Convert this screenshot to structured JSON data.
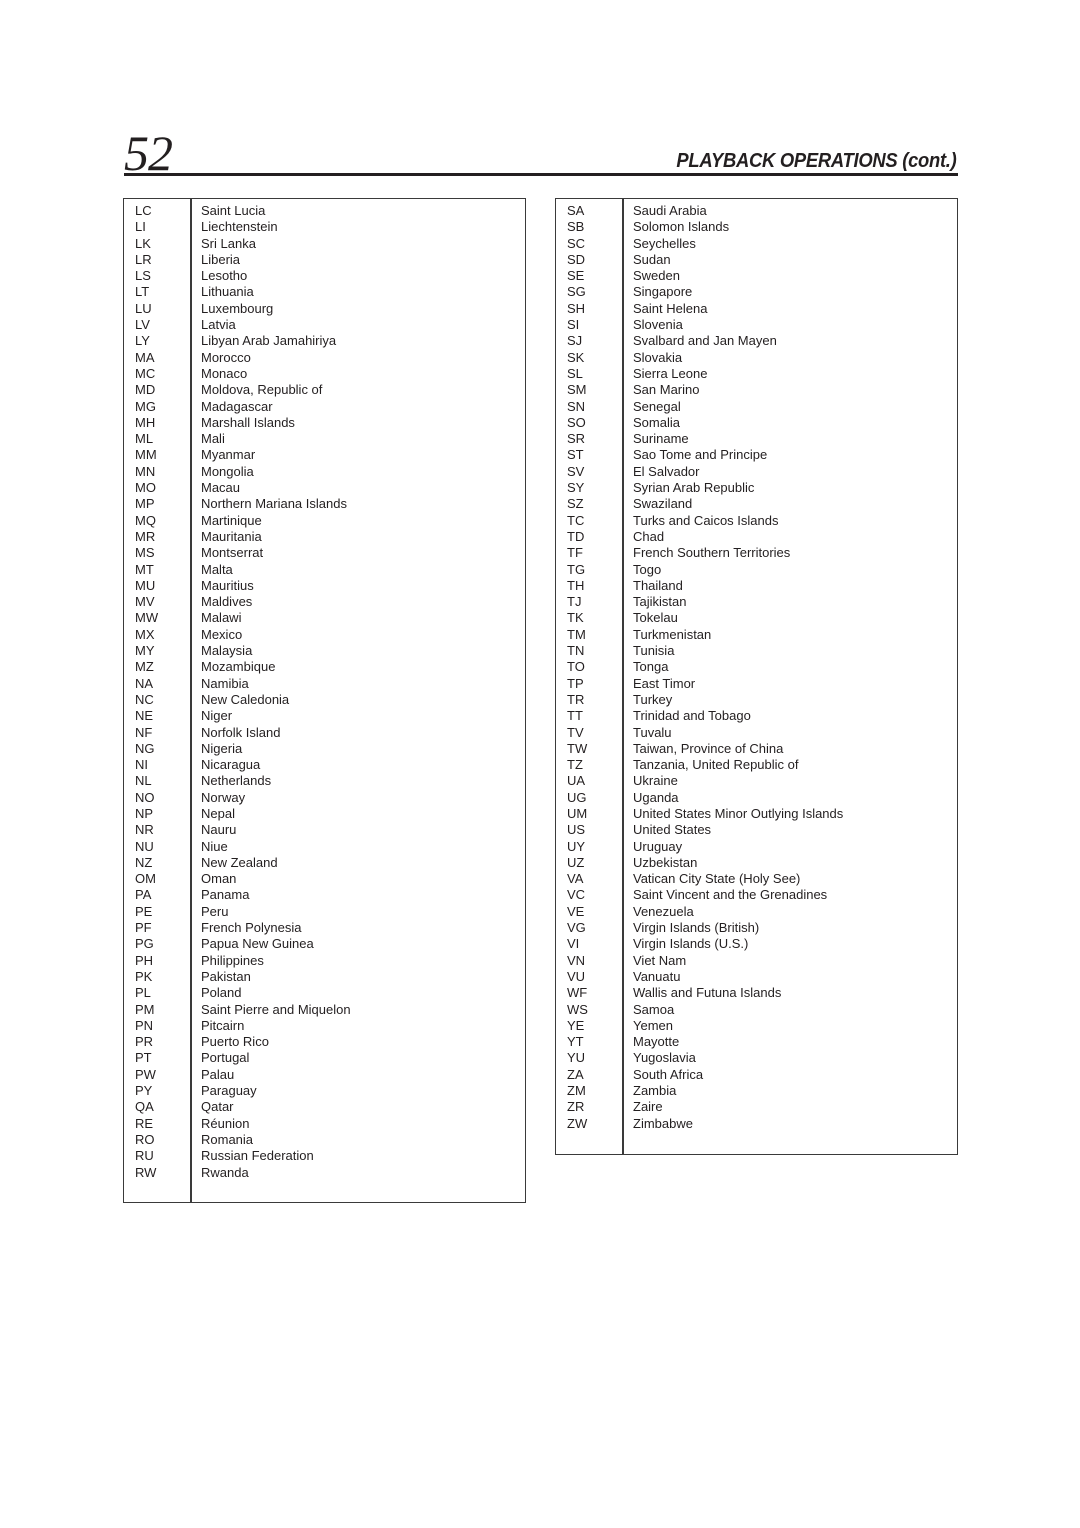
{
  "header": {
    "page_number": "52",
    "section_title": "PLAYBACK OPERATIONS (cont.)"
  },
  "left_table": [
    {
      "code": "LC",
      "name": "Saint Lucia"
    },
    {
      "code": "LI",
      "name": "Liechtenstein"
    },
    {
      "code": "LK",
      "name": "Sri Lanka"
    },
    {
      "code": "LR",
      "name": "Liberia"
    },
    {
      "code": "LS",
      "name": "Lesotho"
    },
    {
      "code": "LT",
      "name": "Lithuania"
    },
    {
      "code": "LU",
      "name": "Luxembourg"
    },
    {
      "code": "LV",
      "name": "Latvia"
    },
    {
      "code": "LY",
      "name": "Libyan Arab Jamahiriya"
    },
    {
      "code": "MA",
      "name": "Morocco"
    },
    {
      "code": "MC",
      "name": "Monaco"
    },
    {
      "code": "MD",
      "name": "Moldova, Republic of"
    },
    {
      "code": "MG",
      "name": "Madagascar"
    },
    {
      "code": "MH",
      "name": "Marshall Islands"
    },
    {
      "code": "ML",
      "name": "Mali"
    },
    {
      "code": "MM",
      "name": "Myanmar"
    },
    {
      "code": "MN",
      "name": "Mongolia"
    },
    {
      "code": "MO",
      "name": "Macau"
    },
    {
      "code": "MP",
      "name": "Northern Mariana Islands"
    },
    {
      "code": "MQ",
      "name": "Martinique"
    },
    {
      "code": "MR",
      "name": "Mauritania"
    },
    {
      "code": "MS",
      "name": "Montserrat"
    },
    {
      "code": "MT",
      "name": "Malta"
    },
    {
      "code": "MU",
      "name": "Mauritius"
    },
    {
      "code": "MV",
      "name": "Maldives"
    },
    {
      "code": "MW",
      "name": "Malawi"
    },
    {
      "code": "MX",
      "name": "Mexico"
    },
    {
      "code": "MY",
      "name": "Malaysia"
    },
    {
      "code": "MZ",
      "name": "Mozambique"
    },
    {
      "code": "NA",
      "name": "Namibia"
    },
    {
      "code": "NC",
      "name": "New Caledonia"
    },
    {
      "code": "NE",
      "name": "Niger"
    },
    {
      "code": "NF",
      "name": "Norfolk Island"
    },
    {
      "code": "NG",
      "name": "Nigeria"
    },
    {
      "code": "NI",
      "name": "Nicaragua"
    },
    {
      "code": "NL",
      "name": "Netherlands"
    },
    {
      "code": "NO",
      "name": "Norway"
    },
    {
      "code": "NP",
      "name": "Nepal"
    },
    {
      "code": "NR",
      "name": "Nauru"
    },
    {
      "code": "NU",
      "name": "Niue"
    },
    {
      "code": "NZ",
      "name": "New Zealand"
    },
    {
      "code": "OM",
      "name": "Oman"
    },
    {
      "code": "PA",
      "name": "Panama"
    },
    {
      "code": "PE",
      "name": "Peru"
    },
    {
      "code": "PF",
      "name": "French Polynesia"
    },
    {
      "code": "PG",
      "name": "Papua New Guinea"
    },
    {
      "code": "PH",
      "name": "Philippines"
    },
    {
      "code": "PK",
      "name": "Pakistan"
    },
    {
      "code": "PL",
      "name": "Poland"
    },
    {
      "code": "PM",
      "name": "Saint Pierre and Miquelon"
    },
    {
      "code": "PN",
      "name": "Pitcairn"
    },
    {
      "code": "PR",
      "name": "Puerto Rico"
    },
    {
      "code": "PT",
      "name": "Portugal"
    },
    {
      "code": "PW",
      "name": "Palau"
    },
    {
      "code": "PY",
      "name": "Paraguay"
    },
    {
      "code": "QA",
      "name": "Qatar"
    },
    {
      "code": "RE",
      "name": "Réunion"
    },
    {
      "code": "RO",
      "name": "Romania"
    },
    {
      "code": "RU",
      "name": "Russian Federation"
    },
    {
      "code": "RW",
      "name": "Rwanda"
    }
  ],
  "right_table": [
    {
      "code": "SA",
      "name": "Saudi Arabia"
    },
    {
      "code": "SB",
      "name": "Solomon Islands"
    },
    {
      "code": "SC",
      "name": "Seychelles"
    },
    {
      "code": "SD",
      "name": "Sudan"
    },
    {
      "code": "SE",
      "name": "Sweden"
    },
    {
      "code": "SG",
      "name": "Singapore"
    },
    {
      "code": "SH",
      "name": "Saint Helena"
    },
    {
      "code": "SI",
      "name": "Slovenia"
    },
    {
      "code": "SJ",
      "name": "Svalbard and Jan Mayen"
    },
    {
      "code": "SK",
      "name": "Slovakia"
    },
    {
      "code": "SL",
      "name": "Sierra Leone"
    },
    {
      "code": "SM",
      "name": "San Marino"
    },
    {
      "code": "SN",
      "name": "Senegal"
    },
    {
      "code": "SO",
      "name": "Somalia"
    },
    {
      "code": "SR",
      "name": "Suriname"
    },
    {
      "code": "ST",
      "name": "Sao Tome and Principe"
    },
    {
      "code": "SV",
      "name": "El Salvador"
    },
    {
      "code": "SY",
      "name": "Syrian Arab Republic"
    },
    {
      "code": "SZ",
      "name": "Swaziland"
    },
    {
      "code": "TC",
      "name": "Turks and Caicos Islands"
    },
    {
      "code": "TD",
      "name": "Chad"
    },
    {
      "code": "TF",
      "name": "French Southern Territories"
    },
    {
      "code": "TG",
      "name": "Togo"
    },
    {
      "code": "TH",
      "name": "Thailand"
    },
    {
      "code": "TJ",
      "name": "Tajikistan"
    },
    {
      "code": "TK",
      "name": "Tokelau"
    },
    {
      "code": "TM",
      "name": "Turkmenistan"
    },
    {
      "code": "TN",
      "name": "Tunisia"
    },
    {
      "code": "TO",
      "name": "Tonga"
    },
    {
      "code": "TP",
      "name": "East Timor"
    },
    {
      "code": "TR",
      "name": "Turkey"
    },
    {
      "code": "TT",
      "name": "Trinidad and Tobago"
    },
    {
      "code": "TV",
      "name": "Tuvalu"
    },
    {
      "code": "TW",
      "name": "Taiwan, Province of China"
    },
    {
      "code": "TZ",
      "name": "Tanzania, United Republic of"
    },
    {
      "code": "UA",
      "name": "Ukraine"
    },
    {
      "code": "UG",
      "name": "Uganda"
    },
    {
      "code": "UM",
      "name": "United States Minor Outlying Islands"
    },
    {
      "code": "US",
      "name": "United States"
    },
    {
      "code": "UY",
      "name": "Uruguay"
    },
    {
      "code": "UZ",
      "name": "Uzbekistan"
    },
    {
      "code": "VA",
      "name": "Vatican City State (Holy See)"
    },
    {
      "code": "VC",
      "name": "Saint Vincent and the Grenadines"
    },
    {
      "code": "VE",
      "name": "Venezuela"
    },
    {
      "code": "VG",
      "name": "Virgin Islands (British)"
    },
    {
      "code": "VI",
      "name": "Virgin Islands (U.S.)"
    },
    {
      "code": "VN",
      "name": "Viet Nam"
    },
    {
      "code": "VU",
      "name": "Vanuatu"
    },
    {
      "code": "WF",
      "name": "Wallis and Futuna Islands"
    },
    {
      "code": "WS",
      "name": "Samoa"
    },
    {
      "code": "YE",
      "name": "Yemen"
    },
    {
      "code": "YT",
      "name": "Mayotte"
    },
    {
      "code": "YU",
      "name": "Yugoslavia"
    },
    {
      "code": "ZA",
      "name": "South Africa"
    },
    {
      "code": "ZM",
      "name": "Zambia"
    },
    {
      "code": "ZR",
      "name": "Zaire"
    },
    {
      "code": "ZW",
      "name": "Zimbabwe"
    }
  ]
}
